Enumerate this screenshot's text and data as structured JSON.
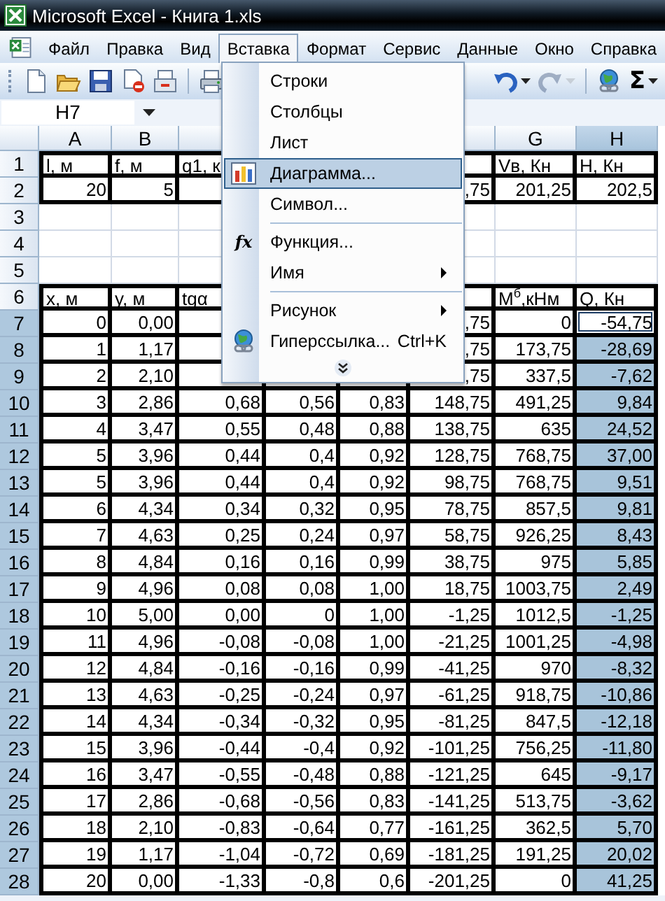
{
  "window": {
    "title": "Microsoft Excel - Книга 1.xls"
  },
  "menu_bar": [
    {
      "label": "Файл",
      "selected": false
    },
    {
      "label": "Правка",
      "selected": false
    },
    {
      "label": "Вид",
      "selected": false
    },
    {
      "label": "Вставка",
      "selected": true
    },
    {
      "label": "Формат",
      "selected": false
    },
    {
      "label": "Сервис",
      "selected": false
    },
    {
      "label": "Данные",
      "selected": false
    },
    {
      "label": "Окно",
      "selected": false
    },
    {
      "label": "Справка",
      "selected": false
    }
  ],
  "toolbar": [
    {
      "kind": "new",
      "disabled": false,
      "dropdown": false
    },
    {
      "kind": "open",
      "disabled": false,
      "dropdown": false
    },
    {
      "kind": "save",
      "disabled": false,
      "dropdown": false
    },
    {
      "kind": "permission",
      "disabled": false,
      "dropdown": false
    },
    {
      "kind": "email",
      "disabled": false,
      "dropdown": false
    },
    {
      "kind": "print",
      "disabled": false,
      "dropdown": false
    },
    {
      "kind": "undo",
      "disabled": false,
      "dropdown": true
    },
    {
      "kind": "redo",
      "disabled": true,
      "dropdown": true
    },
    {
      "kind": "hyperlink",
      "disabled": false,
      "dropdown": false
    },
    {
      "kind": "sum",
      "label": "Σ",
      "disabled": false,
      "dropdown": true
    }
  ],
  "name_box": "H7",
  "insert_menu": [
    {
      "kind": "item",
      "label": "Строки",
      "selected": false
    },
    {
      "kind": "item",
      "label": "Столбцы",
      "selected": false
    },
    {
      "kind": "item",
      "label": "Лист",
      "selected": false
    },
    {
      "kind": "chart",
      "label": "Диаграмма...",
      "selected": true
    },
    {
      "kind": "item",
      "label": "Символ...",
      "selected": false
    },
    {
      "kind": "separator"
    },
    {
      "kind": "item",
      "label": "Функция...",
      "glyph": "fx",
      "selected": false
    },
    {
      "kind": "item",
      "label": "Имя",
      "submenu": true,
      "selected": false
    },
    {
      "kind": "separator"
    },
    {
      "kind": "item",
      "label": "Рисунок",
      "submenu": true,
      "selected": false
    },
    {
      "kind": "link",
      "label": "Гиперссылка...",
      "shortcut": "Ctrl+K",
      "selected": false
    },
    {
      "kind": "expand"
    }
  ],
  "columns": {
    "a": {
      "label": "A",
      "selected": false
    },
    "b": {
      "label": "B",
      "selected": false
    },
    "g": {
      "label": "G",
      "selected": false
    },
    "h": {
      "label": "H",
      "selected": true
    }
  },
  "rows": [
    {
      "number": "1",
      "kind": "header",
      "selected": false,
      "active": false,
      "cells": {
        "a": "l, м",
        "b": "f, м",
        "c": "q1, к",
        "g": "Vв, Кн",
        "h": "Н, Кн"
      }
    },
    {
      "number": "2",
      "kind": "data",
      "selected": false,
      "active": false,
      "cells": {
        "a": "20",
        "b": "5",
        "f": ",75",
        "g": "201,25",
        "h": "202,5"
      }
    },
    {
      "number": "3",
      "kind": "empty",
      "selected": false,
      "active": false
    },
    {
      "number": "4",
      "kind": "empty",
      "selected": false,
      "active": false
    },
    {
      "number": "5",
      "kind": "empty",
      "selected": false,
      "active": false
    },
    {
      "number": "6",
      "kind": "header",
      "selected": false,
      "active": false,
      "cells": {
        "a": "x, м",
        "b": "y, м",
        "c": "tgα",
        "g": "М$^{б}$,кНм",
        "h": "Q, Кн"
      }
    },
    {
      "number": "7",
      "kind": "data",
      "selected": true,
      "active": true,
      "cells": {
        "a": "0",
        "b": "0,00",
        "f": ",75",
        "g": "0",
        "h": "-54,75"
      }
    },
    {
      "number": "8",
      "kind": "data",
      "selected": true,
      "active": false,
      "cells": {
        "a": "1",
        "b": "1,17",
        "f": ",75",
        "g": "173,75",
        "h": "-28,69"
      }
    },
    {
      "number": "9",
      "kind": "data",
      "selected": true,
      "active": false,
      "cells": {
        "a": "2",
        "b": "2,10",
        "f": ",75",
        "g": "337,5",
        "h": "-7,62"
      }
    },
    {
      "number": "10",
      "kind": "data",
      "selected": true,
      "active": false,
      "cells": {
        "a": "3",
        "b": "2,86",
        "c": "0,68",
        "d": "0,56",
        "e": "0,83",
        "f": "148,75",
        "g": "491,25",
        "h": "9,84"
      }
    },
    {
      "number": "11",
      "kind": "data",
      "selected": true,
      "active": false,
      "cells": {
        "a": "4",
        "b": "3,47",
        "c": "0,55",
        "d": "0,48",
        "e": "0,88",
        "f": "138,75",
        "g": "635",
        "h": "24,52"
      }
    },
    {
      "number": "12",
      "kind": "data",
      "selected": true,
      "active": false,
      "cells": {
        "a": "5",
        "b": "3,96",
        "c": "0,44",
        "d": "0,4",
        "e": "0,92",
        "f": "128,75",
        "g": "768,75",
        "h": "37,00"
      }
    },
    {
      "number": "13",
      "kind": "data",
      "selected": true,
      "active": false,
      "cells": {
        "a": "5",
        "b": "3,96",
        "c": "0,44",
        "d": "0,4",
        "e": "0,92",
        "f": "98,75",
        "g": "768,75",
        "h": "9,51"
      }
    },
    {
      "number": "14",
      "kind": "data",
      "selected": true,
      "active": false,
      "cells": {
        "a": "6",
        "b": "4,34",
        "c": "0,34",
        "d": "0,32",
        "e": "0,95",
        "f": "78,75",
        "g": "857,5",
        "h": "9,81"
      }
    },
    {
      "number": "15",
      "kind": "data",
      "selected": true,
      "active": false,
      "cells": {
        "a": "7",
        "b": "4,63",
        "c": "0,25",
        "d": "0,24",
        "e": "0,97",
        "f": "58,75",
        "g": "926,25",
        "h": "8,43"
      }
    },
    {
      "number": "16",
      "kind": "data",
      "selected": true,
      "active": false,
      "cells": {
        "a": "8",
        "b": "4,84",
        "c": "0,16",
        "d": "0,16",
        "e": "0,99",
        "f": "38,75",
        "g": "975",
        "h": "5,85"
      }
    },
    {
      "number": "17",
      "kind": "data",
      "selected": true,
      "active": false,
      "cells": {
        "a": "9",
        "b": "4,96",
        "c": "0,08",
        "d": "0,08",
        "e": "1,00",
        "f": "18,75",
        "g": "1003,75",
        "h": "2,49"
      }
    },
    {
      "number": "18",
      "kind": "data",
      "selected": true,
      "active": false,
      "cells": {
        "a": "10",
        "b": "5,00",
        "c": "0,00",
        "d": "0",
        "e": "1,00",
        "f": "-1,25",
        "g": "1012,5",
        "h": "-1,25"
      }
    },
    {
      "number": "19",
      "kind": "data",
      "selected": true,
      "active": false,
      "cells": {
        "a": "11",
        "b": "4,96",
        "c": "-0,08",
        "d": "-0,08",
        "e": "1,00",
        "f": "-21,25",
        "g": "1001,25",
        "h": "-4,98"
      }
    },
    {
      "number": "20",
      "kind": "data",
      "selected": true,
      "active": false,
      "cells": {
        "a": "12",
        "b": "4,84",
        "c": "-0,16",
        "d": "-0,16",
        "e": "0,99",
        "f": "-41,25",
        "g": "970",
        "h": "-8,32"
      }
    },
    {
      "number": "21",
      "kind": "data",
      "selected": true,
      "active": false,
      "cells": {
        "a": "13",
        "b": "4,63",
        "c": "-0,25",
        "d": "-0,24",
        "e": "0,97",
        "f": "-61,25",
        "g": "918,75",
        "h": "-10,86"
      }
    },
    {
      "number": "22",
      "kind": "data",
      "selected": true,
      "active": false,
      "cells": {
        "a": "14",
        "b": "4,34",
        "c": "-0,34",
        "d": "-0,32",
        "e": "0,95",
        "f": "-81,25",
        "g": "847,5",
        "h": "-12,18"
      }
    },
    {
      "number": "23",
      "kind": "data",
      "selected": true,
      "active": false,
      "cells": {
        "a": "15",
        "b": "3,96",
        "c": "-0,44",
        "d": "-0,4",
        "e": "0,92",
        "f": "-101,25",
        "g": "756,25",
        "h": "-11,80"
      }
    },
    {
      "number": "24",
      "kind": "data",
      "selected": true,
      "active": false,
      "cells": {
        "a": "16",
        "b": "3,47",
        "c": "-0,55",
        "d": "-0,48",
        "e": "0,88",
        "f": "-121,25",
        "g": "645",
        "h": "-9,17"
      }
    },
    {
      "number": "25",
      "kind": "data",
      "selected": true,
      "active": false,
      "cells": {
        "a": "17",
        "b": "2,86",
        "c": "-0,68",
        "d": "-0,56",
        "e": "0,83",
        "f": "-141,25",
        "g": "513,75",
        "h": "-3,62"
      }
    },
    {
      "number": "26",
      "kind": "data",
      "selected": true,
      "active": false,
      "cells": {
        "a": "18",
        "b": "2,10",
        "c": "-0,83",
        "d": "-0,64",
        "e": "0,77",
        "f": "-161,25",
        "g": "362,5",
        "h": "5,70"
      }
    },
    {
      "number": "27",
      "kind": "data",
      "selected": true,
      "active": false,
      "cells": {
        "a": "19",
        "b": "1,17",
        "c": "-1,04",
        "d": "-0,72",
        "e": "0,69",
        "f": "-181,25",
        "g": "191,25",
        "h": "20,02"
      }
    },
    {
      "number": "28",
      "kind": "data",
      "selected": true,
      "active": false,
      "cells": {
        "a": "20",
        "b": "0,00",
        "c": "-1,33",
        "d": "-0,8",
        "e": "0,6",
        "f": "-201,25",
        "g": "0",
        "h": "41,25"
      }
    }
  ]
}
